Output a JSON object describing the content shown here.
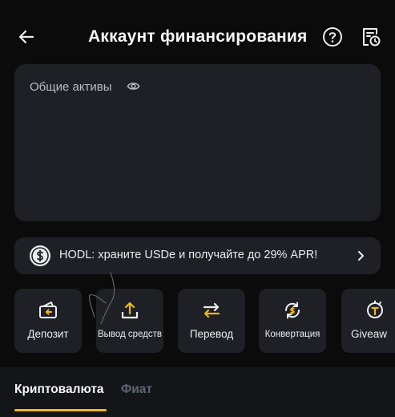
{
  "header": {
    "title": "Аккаунт финансирования",
    "icons": [
      "back-arrow-icon",
      "help-icon",
      "history-icon"
    ]
  },
  "assets": {
    "label": "Общие активы",
    "icon": "eye-icon"
  },
  "promo": {
    "text": "HODL: храните USDe и получайте до 29% APR!",
    "icon": "dollar-coin-icon"
  },
  "actions": [
    {
      "label": "Депозит",
      "icon": "deposit-icon"
    },
    {
      "label": "Вывод средств",
      "icon": "upload-icon"
    },
    {
      "label": "Перевод",
      "icon": "transfer-arrows-icon"
    },
    {
      "label": "Конвертация",
      "icon": "convert-icon"
    },
    {
      "label": "Giveaw",
      "icon": "giveaway-icon"
    }
  ],
  "tabs": [
    {
      "label": "Криптовалюта",
      "active": true
    },
    {
      "label": "Фиат",
      "active": false
    }
  ],
  "colors": {
    "accent": "#f0b90b",
    "card": "#1e2026",
    "background": "#0b0b0b"
  }
}
